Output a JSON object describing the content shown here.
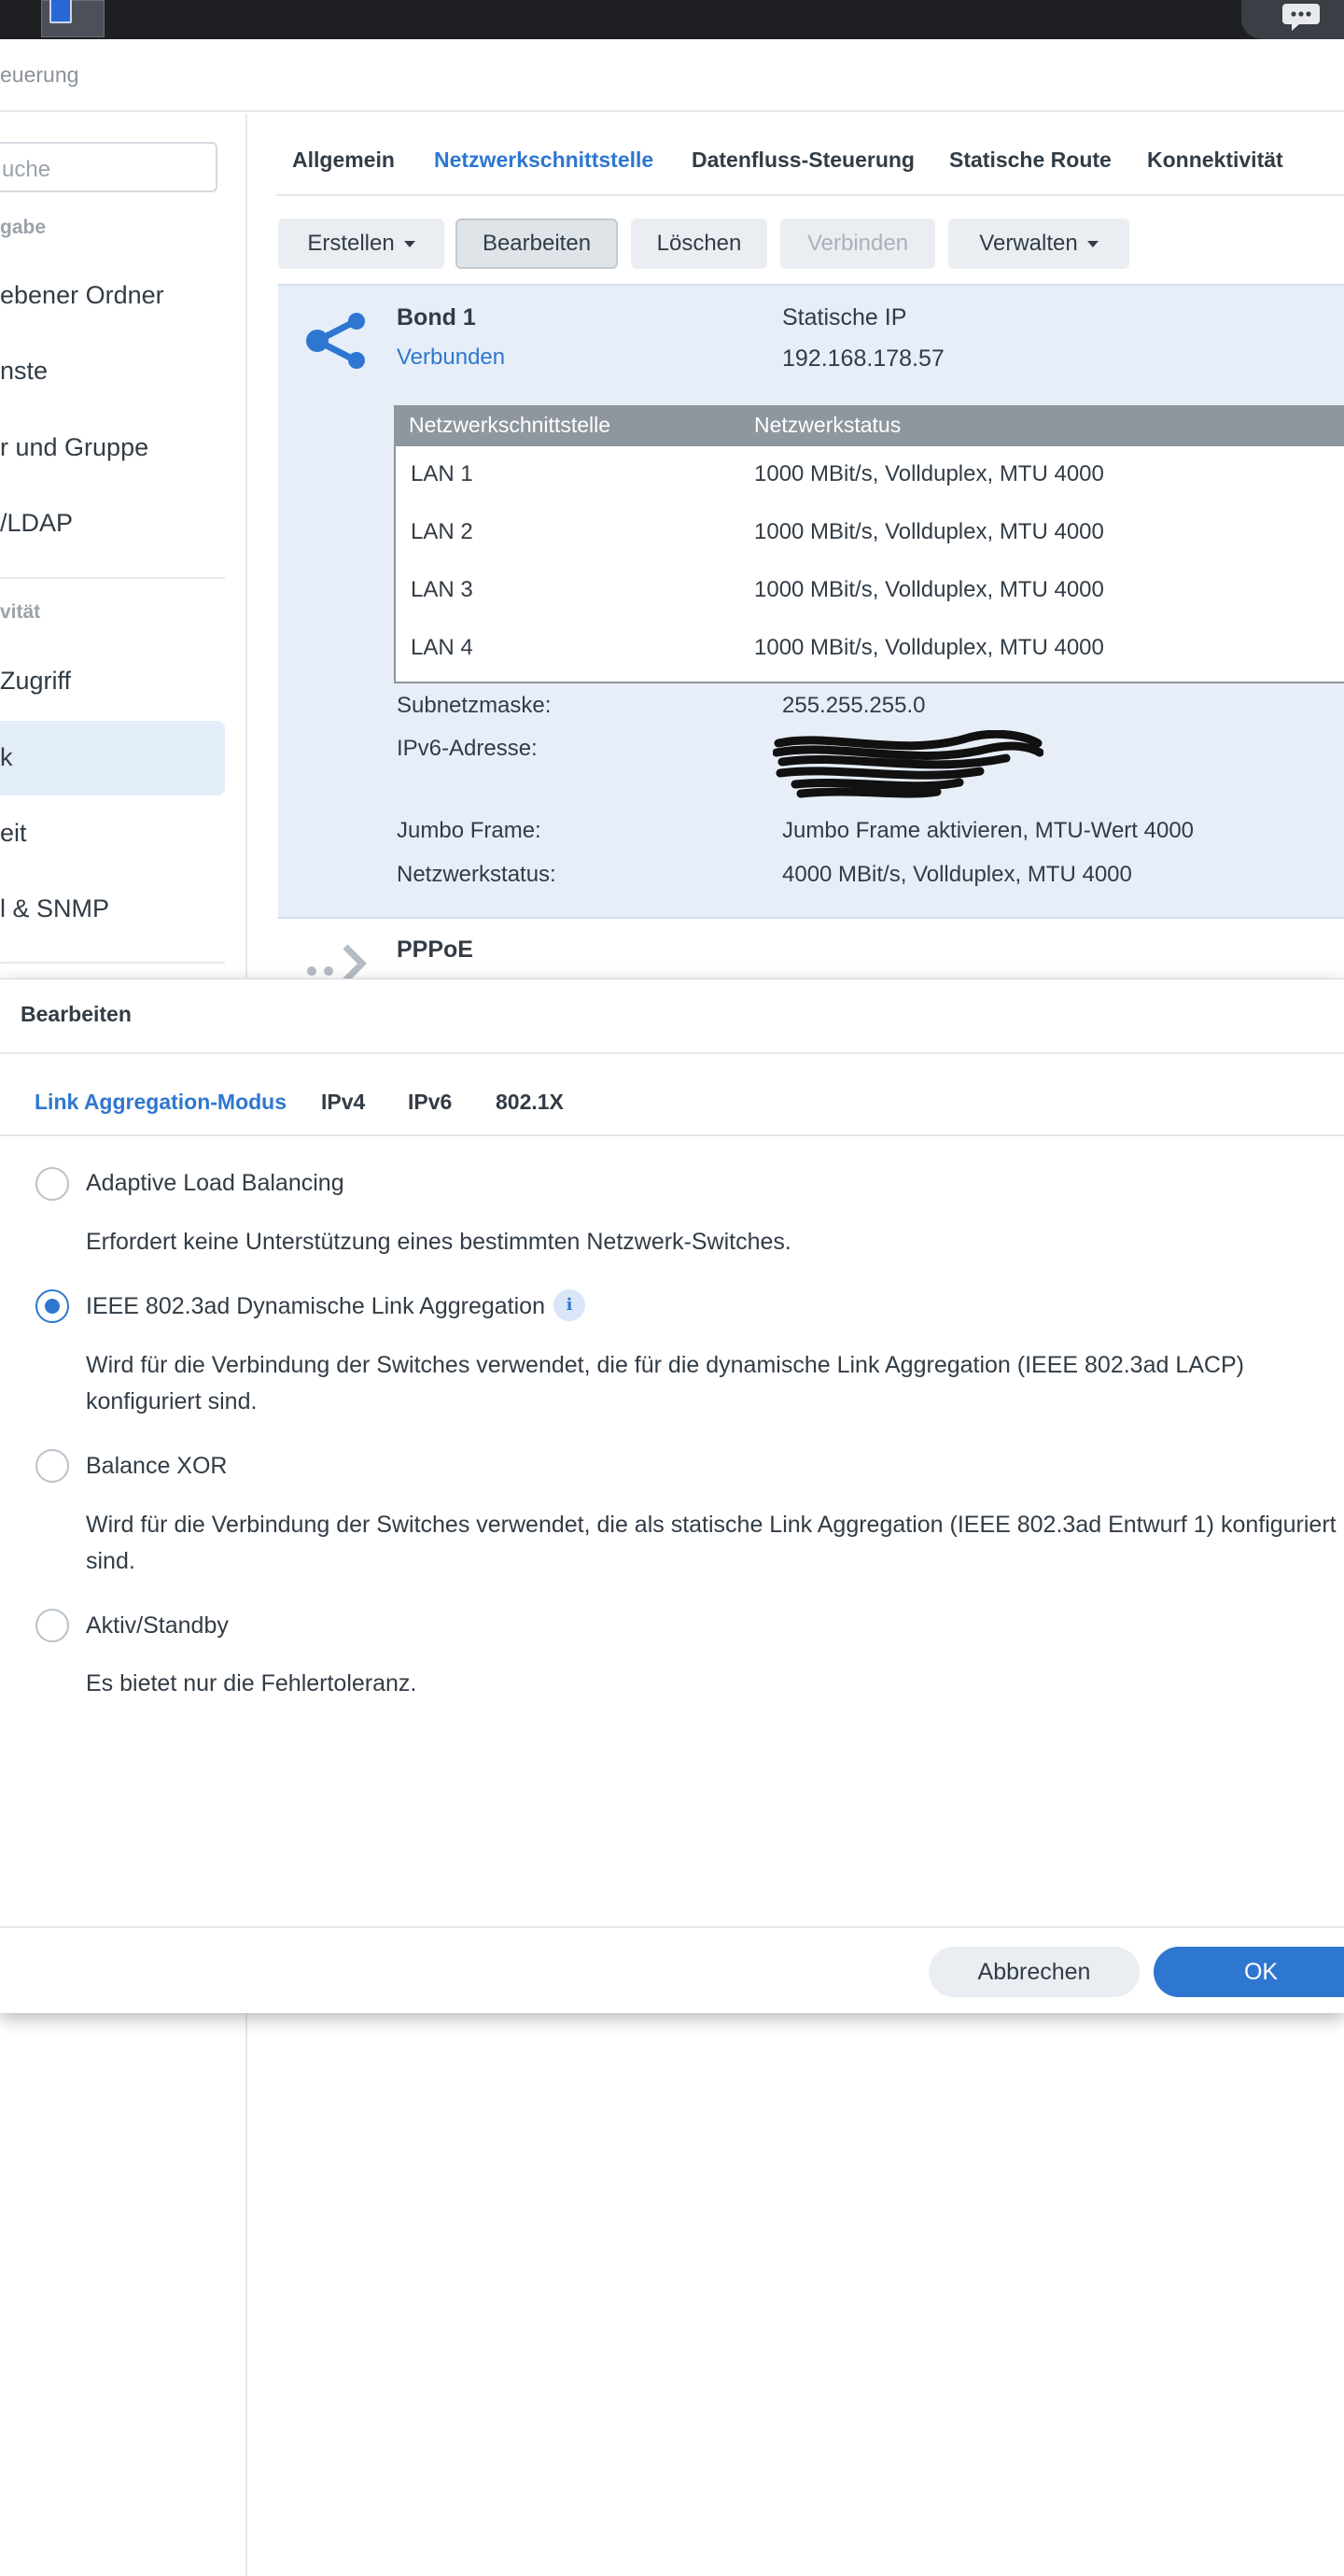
{
  "window": {
    "title": "euerung"
  },
  "sidebar": {
    "search_placeholder": "uche",
    "group1": "gabe",
    "items1": [
      {
        "label": "ebener Ordner"
      },
      {
        "label": "nste"
      },
      {
        "label": "r und Gruppe"
      },
      {
        "label": "/LDAP"
      }
    ],
    "group2": "vität",
    "items2": [
      {
        "label": "Zugriff"
      },
      {
        "label": "k"
      },
      {
        "label": "eit"
      },
      {
        "label": "l & SNMP"
      }
    ]
  },
  "tabs": [
    {
      "label": "Allgemein"
    },
    {
      "label": "Netzwerkschnittstelle"
    },
    {
      "label": "Datenfluss-Steuerung"
    },
    {
      "label": "Statische Route"
    },
    {
      "label": "Konnektivität"
    }
  ],
  "toolbar": {
    "create": "Erstellen",
    "edit": "Bearbeiten",
    "delete": "Löschen",
    "connect": "Verbinden",
    "manage": "Verwalten"
  },
  "bond": {
    "name": "Bond 1",
    "status": "Verbunden",
    "ip_type": "Statische IP",
    "ip": "192.168.178.57",
    "table": {
      "headers": [
        "Netzwerkschnittstelle",
        "Netzwerkstatus"
      ],
      "rows": [
        [
          "LAN 1",
          "1000 MBit/s, Vollduplex, MTU 4000"
        ],
        [
          "LAN 2",
          "1000 MBit/s, Vollduplex, MTU 4000"
        ],
        [
          "LAN 3",
          "1000 MBit/s, Vollduplex, MTU 4000"
        ],
        [
          "LAN 4",
          "1000 MBit/s, Vollduplex, MTU 4000"
        ]
      ]
    },
    "subnet_label": "Subnetzmaske:",
    "subnet_value": "255.255.255.0",
    "ipv6_label": "IPv6-Adresse:",
    "jumbo_label": "Jumbo Frame:",
    "jumbo_value": "Jumbo Frame aktivieren, MTU-Wert 4000",
    "netstatus_label": "Netzwerkstatus:",
    "netstatus_value": "4000 MBit/s, Vollduplex, MTU 4000"
  },
  "pppoe": {
    "name": "PPPoE"
  },
  "dialog": {
    "title": "Bearbeiten",
    "tabs": [
      {
        "label": "Link Aggregation-Modus"
      },
      {
        "label": "IPv4"
      },
      {
        "label": "IPv6"
      },
      {
        "label": "802.1X"
      }
    ],
    "options": [
      {
        "label": "Adaptive Load Balancing",
        "description": "Erfordert keine Unterstützung eines bestimmten Netzwerk-Switches.",
        "checked": false
      },
      {
        "label": "IEEE 802.3ad Dynamische Link Aggregation",
        "description": "Wird für die Verbindung der Switches verwendet, die für die dynamische Link Aggregation (IEEE 802.3ad LACP) konfiguriert sind.",
        "checked": true
      },
      {
        "label": "Balance XOR",
        "description": "Wird für die Verbindung der Switches verwendet, die als statische Link Aggregation (IEEE 802.3ad Entwurf 1) konfiguriert sind.",
        "checked": false
      },
      {
        "label": "Aktiv/Standby",
        "description": "Es bietet nur die Fehlertoleranz.",
        "checked": false
      }
    ],
    "cancel": "Abbrechen",
    "ok": "OK"
  },
  "colors": {
    "accent": "#2e77d0",
    "selected_bg": "#e7eef8",
    "header_gray": "#8e969e"
  }
}
